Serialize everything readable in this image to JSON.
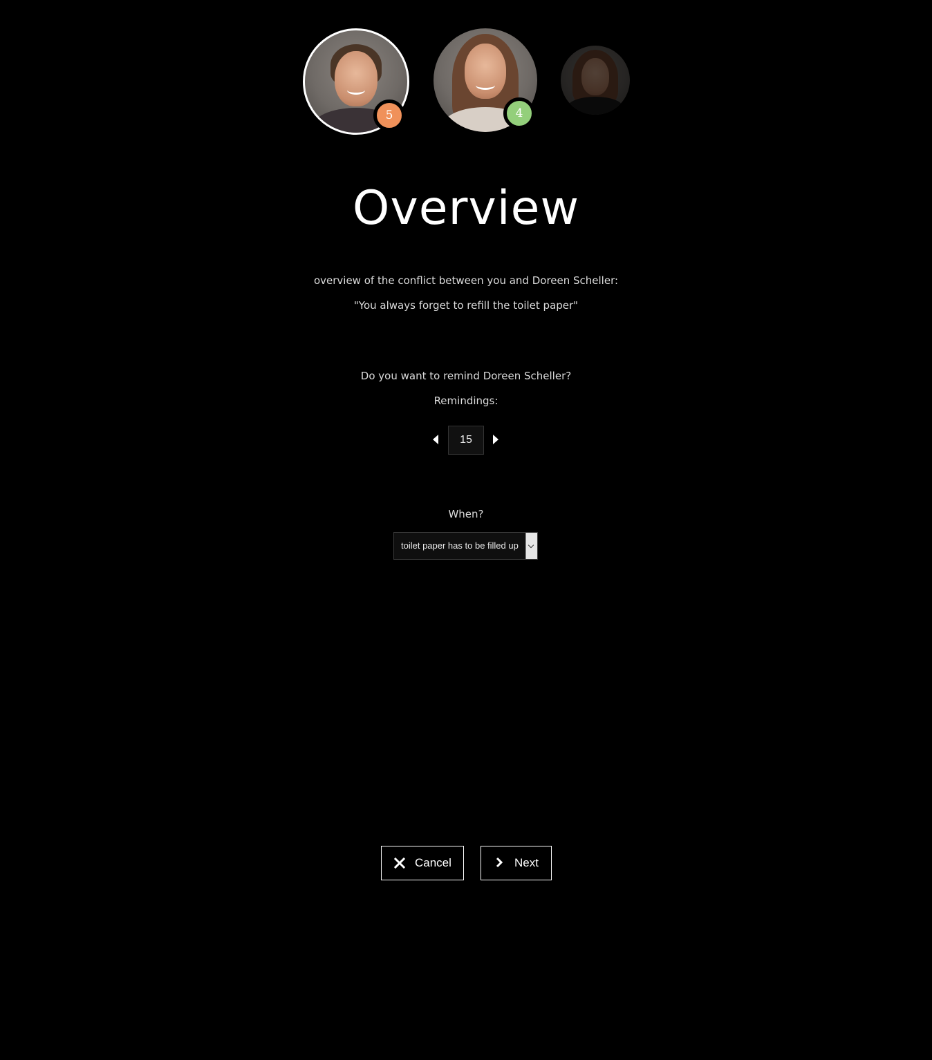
{
  "participants": [
    {
      "name": "participant-1",
      "badge": "5",
      "badge_color": "#f0915a",
      "active": true
    },
    {
      "name": "participant-2",
      "badge": "4",
      "badge_color": "#93cf7b",
      "active": false
    },
    {
      "name": "participant-3",
      "badge": "",
      "active": false
    }
  ],
  "page": {
    "title": "Overview",
    "conflict_intro": "overview of the conflict between you and Doreen Scheller:",
    "conflict_quote": "\"You always forget to refill the toilet paper\"",
    "remind_question": "Do you want to remind Doreen Scheller?",
    "remindings_label": "Remindings:"
  },
  "stepper": {
    "value": "15"
  },
  "when": {
    "label": "When?",
    "selected": "toilet paper has to be filled up"
  },
  "actions": {
    "cancel_label": "Cancel",
    "next_label": "Next"
  },
  "icons": {
    "cancel": "close-icon",
    "next": "chevron-right-icon",
    "stepper_dec": "caret-left-icon",
    "stepper_inc": "caret-right-icon",
    "select": "chevron-down-icon"
  }
}
